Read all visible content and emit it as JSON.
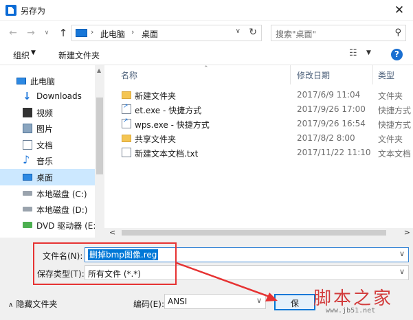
{
  "window": {
    "title": "另存为",
    "close_glyph": "✕"
  },
  "nav": {
    "back_glyph": "←",
    "forward_glyph": "→",
    "recent_glyph": "∨",
    "up_glyph": "↑",
    "address": [
      "此电脑",
      "桌面"
    ],
    "address_sep": "›",
    "dropdown_glyph": "∨",
    "refresh_glyph": "↻",
    "search_placeholder": "搜索\"桌面\"",
    "search_glyph": "⚲"
  },
  "toolbar": {
    "organize": "组织",
    "dropdown_glyph": "▼",
    "new_folder": "新建文件夹",
    "view_glyph": "☷",
    "help_glyph": "?"
  },
  "sidebar": {
    "items": [
      {
        "label": "此电脑",
        "icon": "pc-icon"
      },
      {
        "label": "Downloads",
        "icon": "download-icon",
        "glyph": "↓"
      },
      {
        "label": "视频",
        "icon": "video-icon"
      },
      {
        "label": "图片",
        "icon": "pictures-icon"
      },
      {
        "label": "文档",
        "icon": "documents-icon"
      },
      {
        "label": "音乐",
        "icon": "music-icon",
        "glyph": "♪"
      },
      {
        "label": "桌面",
        "icon": "desktop-icon",
        "selected": true
      },
      {
        "label": "本地磁盘 (C:)",
        "icon": "disk-icon"
      },
      {
        "label": "本地磁盘 (D:)",
        "icon": "disk-icon"
      },
      {
        "label": "DVD 驱动器 (E:",
        "icon": "dvd-icon"
      }
    ],
    "scroll_up_glyph": "▲"
  },
  "file_list": {
    "columns": {
      "name": "名称",
      "date": "修改日期",
      "type": "类型"
    },
    "sort_glyph": "⌃",
    "files": [
      {
        "name": "新建文件夹",
        "date": "2017/6/9 11:04",
        "type": "文件夹",
        "icon": "folder"
      },
      {
        "name": "et.exe - 快捷方式",
        "date": "2017/9/26 17:00",
        "type": "快捷方式",
        "icon": "shortcut"
      },
      {
        "name": "wps.exe - 快捷方式",
        "date": "2017/9/26 16:54",
        "type": "快捷方式",
        "icon": "shortcut"
      },
      {
        "name": "共享文件夹",
        "date": "2017/8/2 8:00",
        "type": "文件夹",
        "icon": "folder"
      },
      {
        "name": "新建文本文档.txt",
        "date": "2017/11/22 11:10",
        "type": "文本文档",
        "icon": "txt"
      }
    ],
    "scroll_left_glyph": "<",
    "scroll_right_glyph": ">"
  },
  "form": {
    "filename_label": "文件名(N):",
    "filename_value": "删掉bmp图像.reg",
    "filetype_label": "保存类型(T):",
    "filetype_value": "所有文件  (*.*)",
    "dropdown_glyph": "∨"
  },
  "footer": {
    "hide_folders_glyph": "∧",
    "hide_folders": "隐藏文件夹",
    "encoding_label": "编码(E):",
    "encoding_value": "ANSI",
    "dropdown_glyph": "∨",
    "save_button": "保"
  },
  "watermark": {
    "text": "脚本之家",
    "url": "www.jb51.net"
  },
  "colors": {
    "accent": "#0078d7",
    "selected": "#cce8ff",
    "annotation": "#e63232"
  }
}
